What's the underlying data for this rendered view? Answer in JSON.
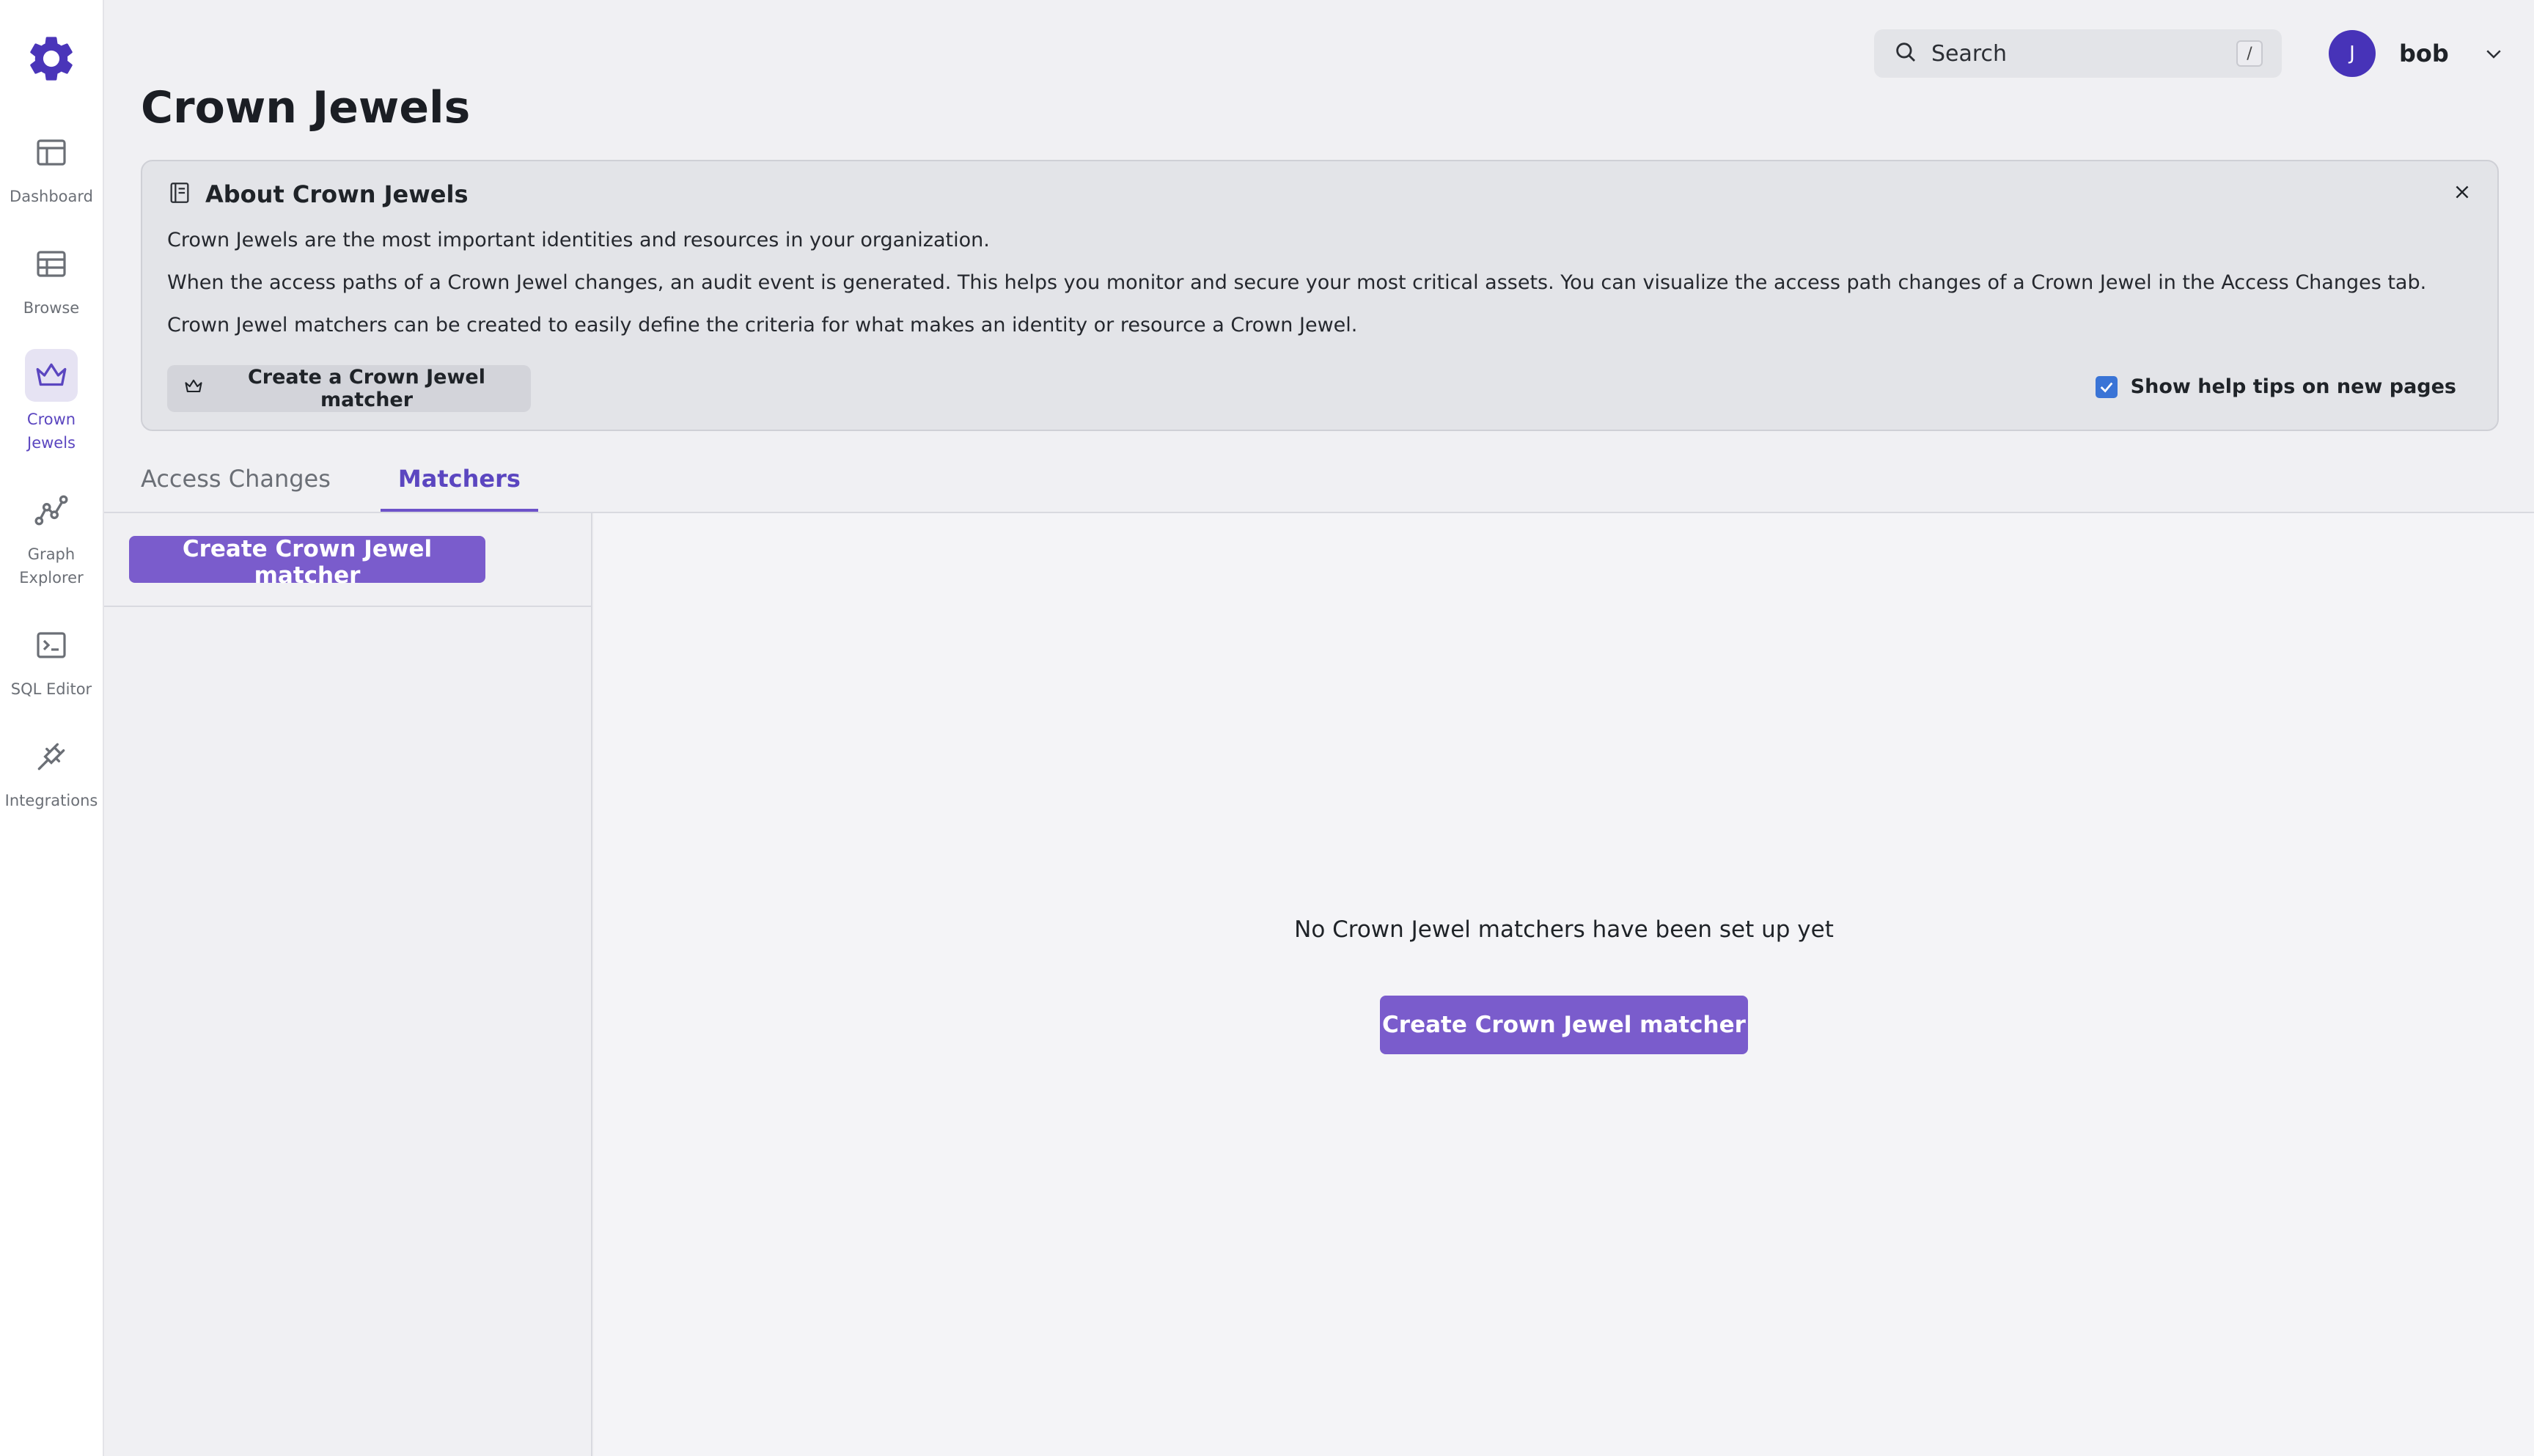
{
  "sidebar": {
    "items": [
      {
        "label": "Dashboard",
        "icon": "dashboard-icon"
      },
      {
        "label": "Browse",
        "icon": "table-icon"
      },
      {
        "label": "Crown\nJewels",
        "icon": "crown-icon",
        "active": true
      },
      {
        "label": "Graph\nExplorer",
        "icon": "graph-icon"
      },
      {
        "label": "SQL Editor",
        "icon": "terminal-icon"
      },
      {
        "label": "Integrations",
        "icon": "plug-icon"
      }
    ]
  },
  "header": {
    "search_placeholder": "Search",
    "search_shortcut": "/",
    "user_initial": "J",
    "user_name": "bob"
  },
  "page": {
    "title": "Crown Jewels"
  },
  "info": {
    "title": "About Crown Jewels",
    "lines": [
      "Crown Jewels are the most important identities and resources in your organization.",
      "When the access paths of a Crown Jewel changes, an audit event is generated. This helps you monitor and secure your most critical assets. You can visualize the access path changes of a Crown Jewel in the Access Changes tab.",
      "Crown Jewel matchers can be created to easily define the criteria for what makes an identity or resource a Crown Jewel."
    ],
    "button_label": "Create a Crown Jewel matcher",
    "help_tip_label": "Show help tips on new pages",
    "help_tip_checked": true
  },
  "tabs": [
    {
      "label": "Access Changes",
      "active": false
    },
    {
      "label": "Matchers",
      "active": true
    }
  ],
  "matchers": {
    "create_label": "Create Crown Jewel matcher",
    "empty_text": "No Crown Jewel matchers have been set up yet",
    "empty_create_label": "Create Crown Jewel matcher"
  },
  "colors": {
    "accent": "#7a5ccc",
    "accent_text": "#5b46c0",
    "avatar": "#4733b8",
    "checkbox": "#3a74d6"
  }
}
